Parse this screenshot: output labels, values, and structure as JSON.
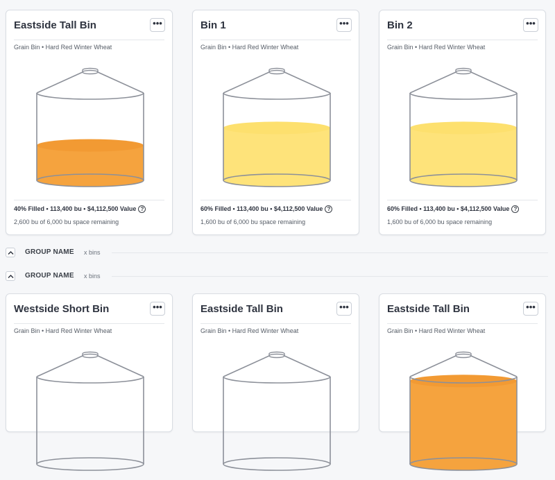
{
  "colors": {
    "orange_fill": "#f5a33e",
    "orange_top": "#f29a33",
    "yellow_fill": "#fee37a",
    "yellow_top": "#fde06e",
    "outline": "#8c9099"
  },
  "menu_label": "•••",
  "help_glyph": "?",
  "top_cards": [
    {
      "title": "Eastside Tall Bin",
      "subtitle": "Grain Bin • Hard Red Winter Wheat",
      "fill_text": "40% Filled • 113,400 bu • $4,112,500 Value",
      "remaining_text": "2,600 bu of 6,000 bu space remaining",
      "fill_fraction": 0.4,
      "fill_color": "orange"
    },
    {
      "title": "Bin 1",
      "subtitle": "Grain Bin • Hard Red Winter Wheat",
      "fill_text": "60% Filled • 113,400 bu • $4,112,500 Value",
      "remaining_text": "1,600 bu of 6,000 bu space remaining",
      "fill_fraction": 0.6,
      "fill_color": "yellow"
    },
    {
      "title": "Bin 2",
      "subtitle": "Grain Bin • Hard Red Winter Wheat",
      "fill_text": "60% Filled • 113,400 bu • $4,112,500 Value",
      "remaining_text": "1,600 bu of 6,000 bu space remaining",
      "fill_fraction": 0.6,
      "fill_color": "yellow"
    }
  ],
  "groups": [
    {
      "name": "GROUP NAME",
      "count": "x bins"
    },
    {
      "name": "GROUP NAME",
      "count": "x bins"
    }
  ],
  "bottom_cards": [
    {
      "title": "Westside Short Bin",
      "subtitle": "Grain Bin • Hard Red Winter Wheat",
      "fill_fraction": 0,
      "fill_color": "none"
    },
    {
      "title": "Eastside Tall Bin",
      "subtitle": "Grain Bin • Hard Red Winter Wheat",
      "fill_fraction": 0,
      "fill_color": "none"
    },
    {
      "title": "Eastside Tall Bin",
      "subtitle": "Grain Bin • Hard Red Winter Wheat",
      "fill_fraction": 0.95,
      "fill_color": "orange"
    }
  ]
}
